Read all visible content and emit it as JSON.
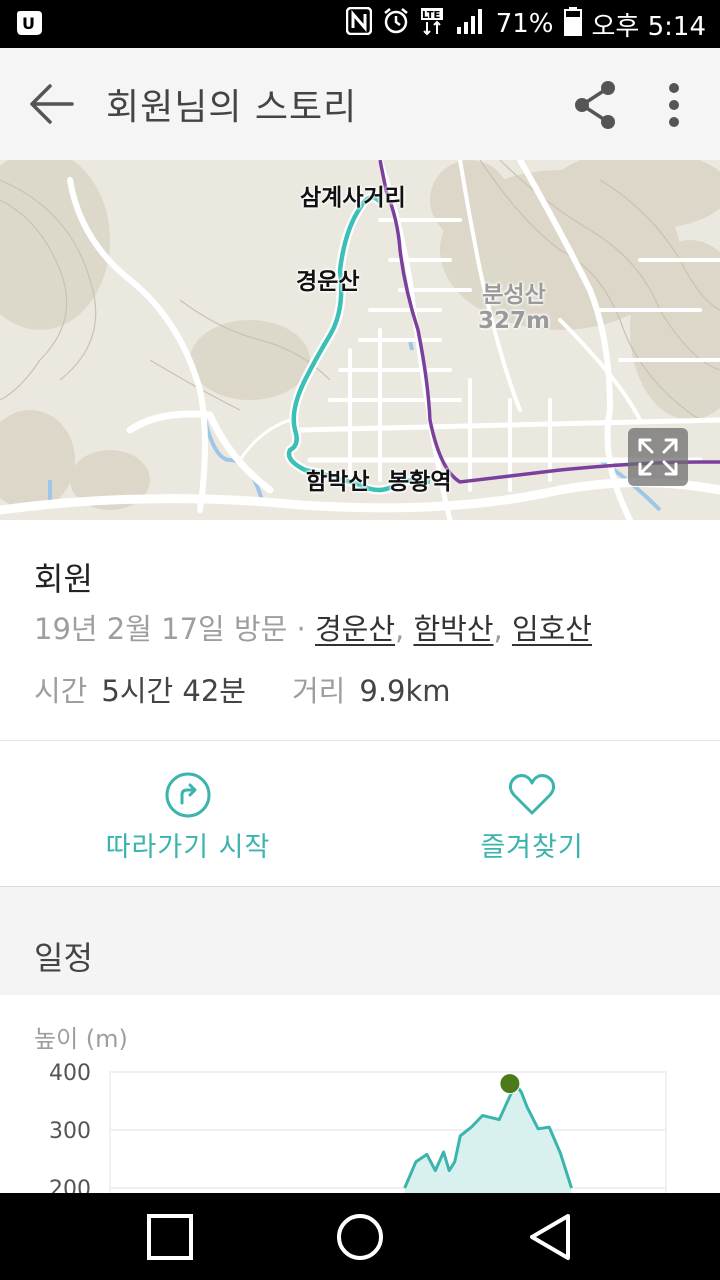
{
  "status_bar": {
    "battery": "71%",
    "time": "오후 5:14",
    "network": "LTE"
  },
  "app_bar": {
    "title": "회원님의 스토리"
  },
  "map": {
    "labels": {
      "samgyesa": "삼계사거리",
      "gyeongunsan": "경운산",
      "bunseongsan": "분성산",
      "bunseongsan_elev": "327m",
      "hambaksan": "함박산",
      "bonghwang": "봉황역"
    }
  },
  "info": {
    "author": "회원",
    "visit_date": "19년 2월 17일 방문 · ",
    "peaks": [
      "경운산",
      "함박산",
      "임호산"
    ],
    "separator": ", ",
    "time_label": "시간",
    "time_value": "5시간 42분",
    "distance_label": "거리",
    "distance_value": "9.9km"
  },
  "actions": {
    "follow": "따라가기 시작",
    "favorite": "즐겨찾기"
  },
  "schedule": {
    "header": "일정"
  },
  "colors": {
    "accent": "#3bb4ad",
    "route": "#3bbfb6",
    "subway": "#7b3f9e"
  },
  "chart_data": {
    "type": "area",
    "ylabel": "높이 (m)",
    "yticks": [
      "400",
      "300",
      "200"
    ],
    "ylim": [
      200,
      400
    ],
    "x": [
      0.53,
      0.55,
      0.57,
      0.585,
      0.6,
      0.61,
      0.62,
      0.63,
      0.65,
      0.67,
      0.7,
      0.72,
      0.73,
      0.74,
      0.75,
      0.77,
      0.79,
      0.81,
      0.83
    ],
    "values": [
      200,
      245,
      258,
      230,
      262,
      230,
      245,
      290,
      305,
      325,
      318,
      360,
      378,
      365,
      340,
      302,
      305,
      260,
      200
    ],
    "peak_marker": 380
  }
}
